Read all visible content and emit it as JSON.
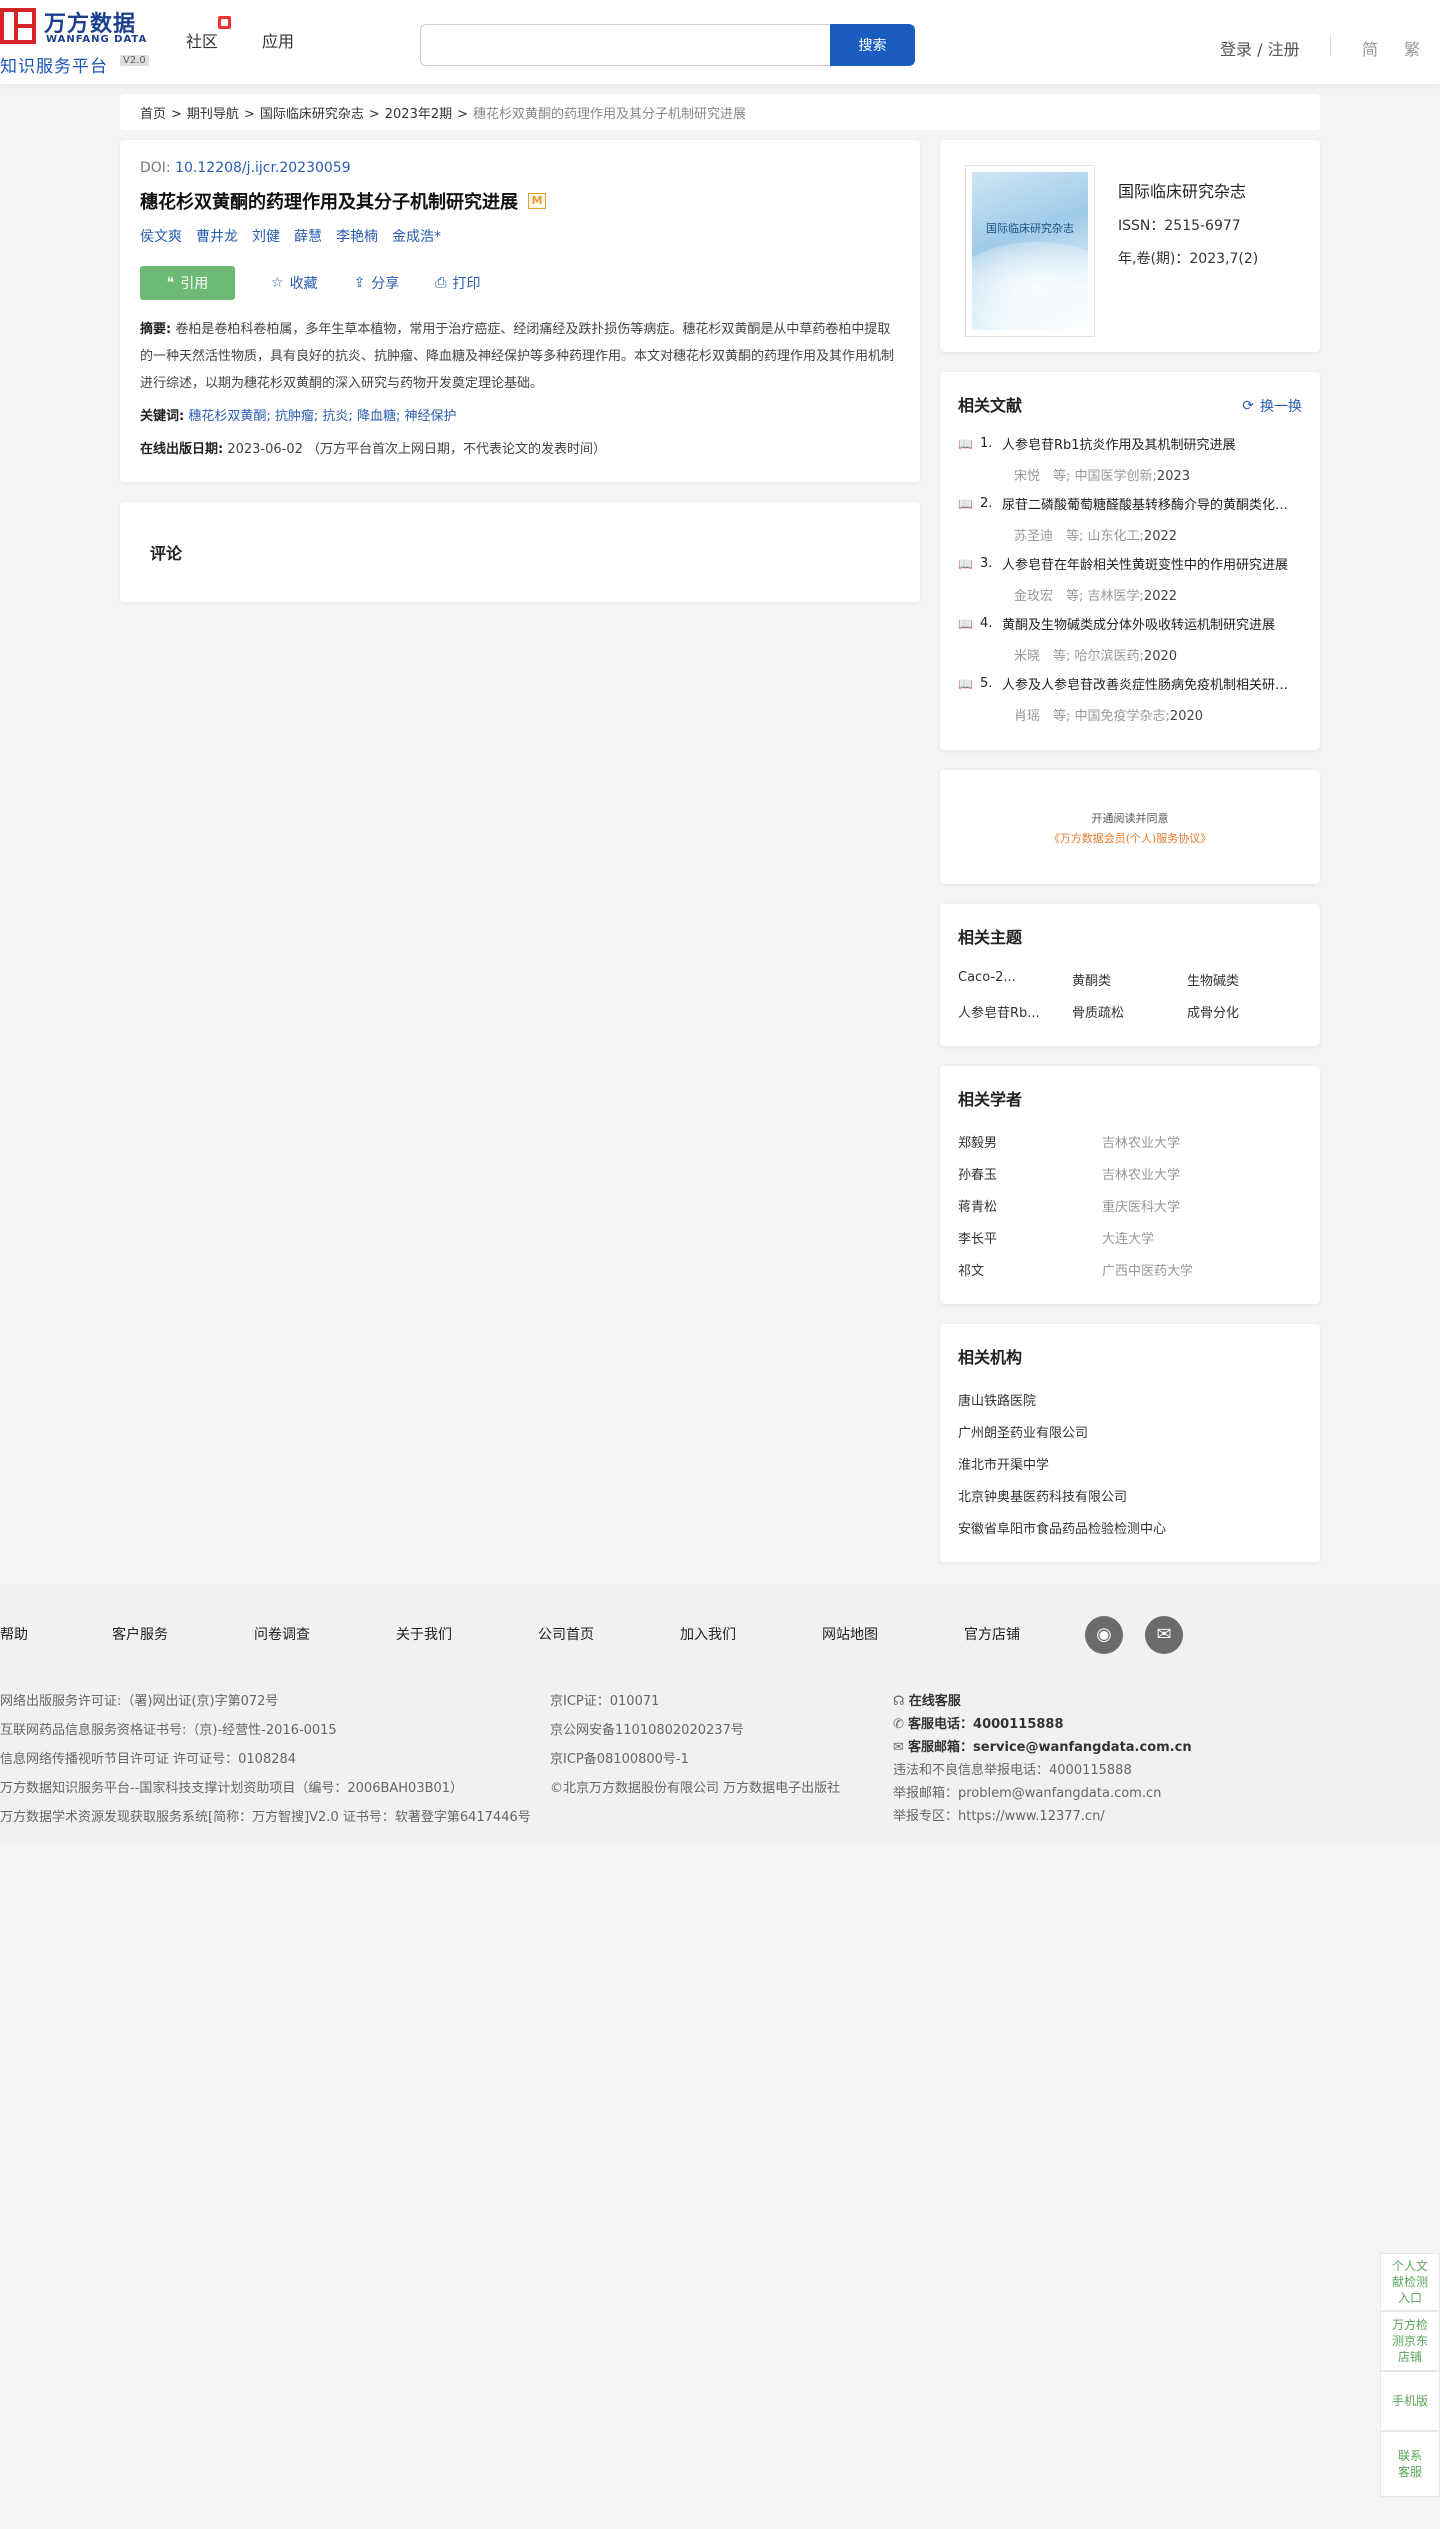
{
  "header": {
    "logo_cn": "万方数据",
    "logo_en": "WANFANG DATA",
    "logo_sub": "知识服务平台",
    "logo_version": "V2.0",
    "nav": [
      "社区",
      "应用"
    ],
    "search_placeholder": "",
    "search_button": "搜索",
    "login": "登录 / 注册",
    "lang_simplified": "简",
    "lang_traditional": "繁"
  },
  "breadcrumb": {
    "items": [
      "首页",
      "期刊导航",
      "国际临床研究杂志",
      "2023年2期"
    ],
    "current": "穗花杉双黄酮的药理作用及其分子机制研究进展",
    "separator": ">"
  },
  "article": {
    "doi_label": "DOI: ",
    "doi": "10.12208/j.ijcr.20230059",
    "title": "穗花杉双黄酮的药理作用及其分子机制研究进展",
    "badge": "M",
    "authors": [
      "侯文爽",
      "曹井龙",
      "刘健",
      "薛慧",
      "李艳楠",
      "金成浩*"
    ],
    "actions": {
      "cite": "引用",
      "collect": "收藏",
      "share": "分享",
      "print": "打印"
    },
    "abstract_label": "摘要:",
    "abstract": "卷柏是卷柏科卷柏属，多年生草本植物，常用于治疗癌症、经闭痛经及跌扑损伤等病症。穗花杉双黄酮是从中草药卷柏中提取的一种天然活性物质，具有良好的抗炎、抗肿瘤、降血糖及神经保护等多种药理作用。本文对穗花杉双黄酮的药理作用及其作用机制进行综述，以期为穗花杉双黄酮的深入研究与药物开发奠定理论基础。",
    "keywords_label": "关键词:",
    "keywords": [
      "穗花杉双黄酮;",
      "抗肿瘤;",
      "抗炎;",
      "降血糖;",
      "神经保护"
    ],
    "pubdate_label": "在线出版日期:",
    "pubdate": "2023-06-02",
    "pubdate_note": "（万方平台首次上网日期，不代表论文的发表时间）"
  },
  "comments": {
    "title": "评论"
  },
  "journal": {
    "cover_title": "国际临床研究杂志",
    "name": "国际临床研究杂志",
    "issn": "ISSN：2515-6977",
    "year_issue": "年,卷(期)：2023,7(2)"
  },
  "related": {
    "title": "相关文献",
    "refresh": "换一换",
    "items": [
      {
        "num": "1.",
        "title": "人参皂苷Rb1抗炎作用及其机制研究进展",
        "author": "宋悦　等;",
        "source": "中国医学创新;",
        "year": "2023"
      },
      {
        "num": "2.",
        "title": "尿苷二磷酸葡萄糖醛酸基转移酶介导的黄酮类化合物代谢研究进展",
        "author": "苏圣迪　等;",
        "source": "山东化工;",
        "year": "2022"
      },
      {
        "num": "3.",
        "title": "人参皂苷在年龄相关性黄斑变性中的作用研究进展",
        "author": "金玫宏　等;",
        "source": "吉林医学;",
        "year": "2022"
      },
      {
        "num": "4.",
        "title": "黄酮及生物碱类成分体外吸收转运机制研究进展",
        "author": "米晓　等;",
        "source": "哈尔滨医药;",
        "year": "2020"
      },
      {
        "num": "5.",
        "title": "人参及人参皂苷改善炎症性肠病免疫机制相关研究进展",
        "author": "肖瑶　等;",
        "source": "中国免疫学杂志;",
        "year": "2020"
      }
    ]
  },
  "service": {
    "line1": "开通阅读并同意",
    "line2": "《万方数据会员(个人)服务协议》"
  },
  "topics": {
    "title": "相关主题",
    "items": [
      "Caco-2...",
      "黄酮类",
      "生物碱类",
      "人参皂苷Rb...",
      "骨质疏松",
      "成骨分化"
    ]
  },
  "scholars": {
    "title": "相关学者",
    "items": [
      {
        "name": "郑毅男",
        "org": "吉林农业大学"
      },
      {
        "name": "孙春玉",
        "org": "吉林农业大学"
      },
      {
        "name": "蒋青松",
        "org": "重庆医科大学"
      },
      {
        "name": "李长平",
        "org": "大连大学"
      },
      {
        "name": "祁文",
        "org": "广西中医药大学"
      }
    ]
  },
  "orgs": {
    "title": "相关机构",
    "items": [
      "唐山铁路医院",
      "广州朗圣药业有限公司",
      "淮北市开渠中学",
      "北京钟奥基医药科技有限公司",
      "安徽省阜阳市食品药品检验检测中心"
    ]
  },
  "footer": {
    "links": [
      "帮助",
      "客户服务",
      "问卷调查",
      "关于我们",
      "公司首页",
      "加入我们",
      "网站地图",
      "官方店铺"
    ],
    "col1": [
      "网络出版服务许可证:（署)网出证(京)字第072号",
      "互联网药品信息服务资格证书号:（京)-经营性-2016-0015",
      "信息网络传播视听节目许可证 许可证号：0108284",
      "万方数据知识服务平台--国家科技支撑计划资助项目（编号：2006BAH03B01）",
      "万方数据学术资源发现获取服务系统[简称：万方智搜]V2.0 证书号：软著登字第6417446号"
    ],
    "col2": [
      "京ICP证：010071",
      "京公网安备11010802020237号",
      "京ICP备08100800号-1",
      "©北京万方数据股份有限公司 万方数据电子出版社"
    ],
    "online_service": "在线客服",
    "phone_label": "客服电话：",
    "phone": "4000115888",
    "email_label": "客服邮箱：",
    "email": "service@wanfangdata.com.cn",
    "report_phone": "违法和不良信息举报电话：4000115888",
    "report_email": "举报邮箱：problem@wanfangdata.com.cn",
    "report_site": "举报专区：https://www.12377.cn/"
  },
  "float_bar": [
    "个人文献检测入口",
    "万方检测京东店铺",
    "手机版",
    "联系客服"
  ]
}
